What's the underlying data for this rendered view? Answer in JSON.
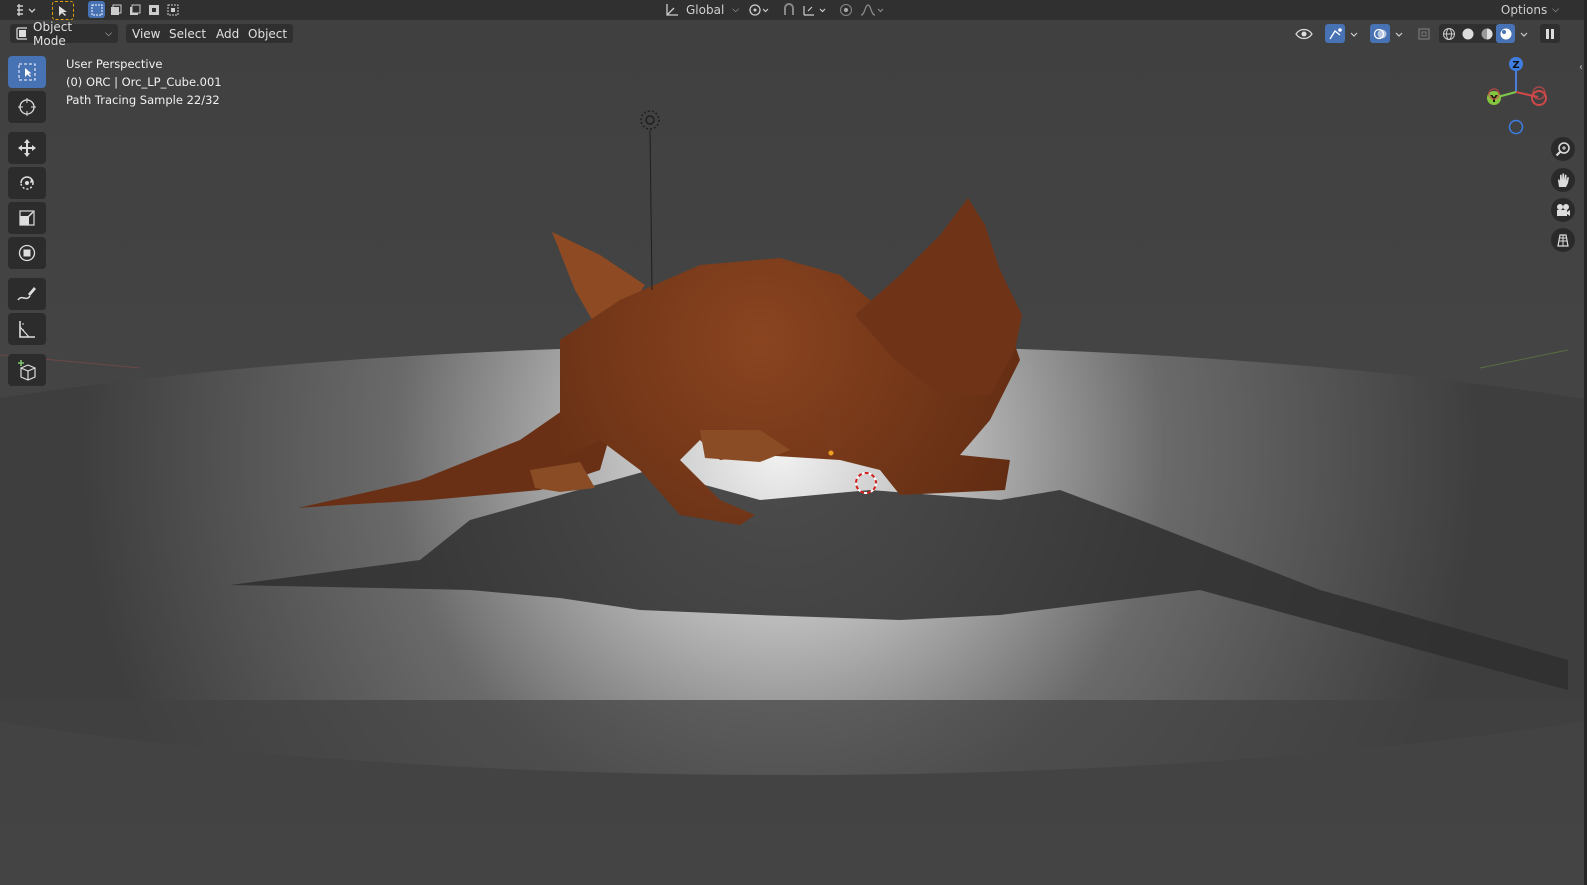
{
  "topbar": {
    "orientation": "Global",
    "options_label": "Options"
  },
  "header": {
    "mode_label": "Object Mode",
    "menus": [
      "View",
      "Select",
      "Add",
      "Object"
    ]
  },
  "overlay": {
    "perspective": "User Perspective",
    "object_info": "(0) ORC | Orc_LP_Cube.001",
    "render_status": "Path Tracing Sample 22/32"
  },
  "gizmo": {
    "z_label": "Z",
    "y_label": "Y"
  },
  "toolbar_icons": [
    "select-box-icon",
    "cursor-icon",
    "move-icon",
    "rotate-icon",
    "scale-icon",
    "transform-icon",
    "annotate-icon",
    "measure-icon",
    "add-cube-icon"
  ],
  "navigation_icons": [
    "zoom-icon",
    "pan-hand-icon",
    "camera-icon",
    "ortho-grid-icon"
  ],
  "colors": {
    "accent": "#4772b3",
    "creature": "#7a3a1c",
    "background": "#3d3d3d"
  }
}
